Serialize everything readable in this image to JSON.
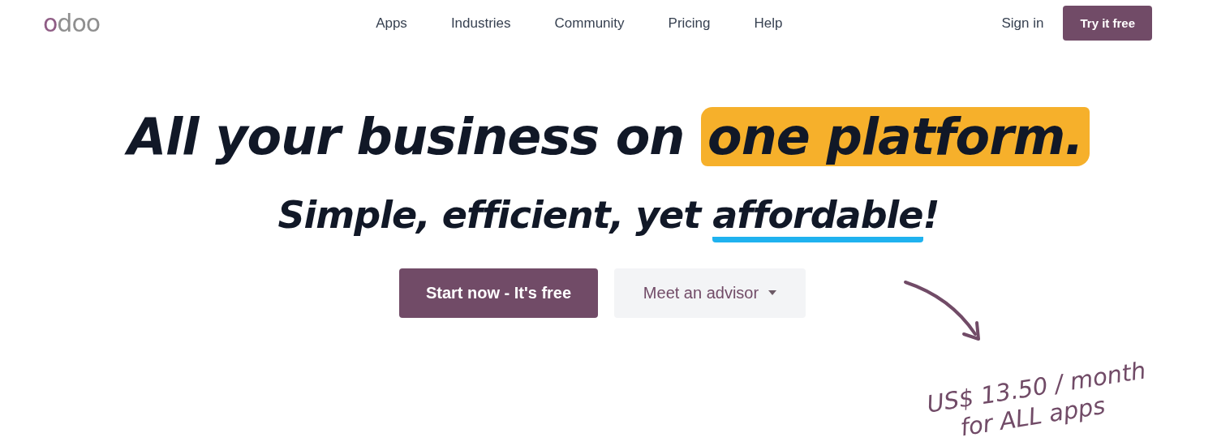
{
  "header": {
    "logo": "odoo",
    "nav": [
      {
        "label": "Apps"
      },
      {
        "label": "Industries"
      },
      {
        "label": "Community"
      },
      {
        "label": "Pricing"
      },
      {
        "label": "Help"
      }
    ],
    "sign_in": "Sign in",
    "cta": "Try it free"
  },
  "hero": {
    "headline": {
      "text": "All your business on",
      "highlight": "one platform."
    },
    "subtitle": {
      "before": "Simple, efficient, yet ",
      "underlined": "affordable",
      "after": "!"
    },
    "buttons": [
      {
        "label": "Start now - It's free",
        "kind": "primary"
      },
      {
        "label": "Meet an advisor",
        "kind": "dropdown"
      }
    ],
    "price_note": [
      "US$ 13.50 / month",
      "for ALL apps"
    ]
  }
}
